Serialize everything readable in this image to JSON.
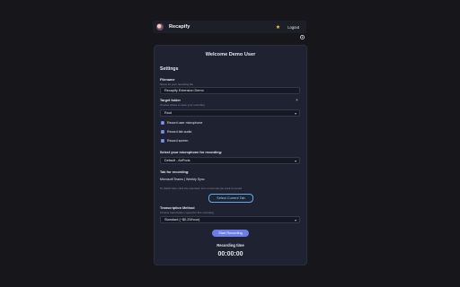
{
  "header": {
    "brand": "Recapify",
    "logout_label": "Logout",
    "star_icon": "star-icon",
    "settings_icon": "gear-icon"
  },
  "main": {
    "welcome": "Welcome Demo User",
    "settings_title": "Settings",
    "filename": {
      "label": "Filename",
      "hint": "Name for your recording file",
      "value": "Recapify Extension Demo"
    },
    "target_folder": {
      "label": "Target folder",
      "hint": "Choose where to save your recording",
      "value": "Root"
    },
    "checkboxes": [
      {
        "label": "Record user microphone",
        "checked": true
      },
      {
        "label": "Record tab audio",
        "checked": true
      },
      {
        "label": "Record screen",
        "checked": true
      }
    ],
    "microphone": {
      "label": "Select your microphone for recording:",
      "value": "Default - AirPods"
    },
    "tab": {
      "label": "Tab for recording:",
      "name": "Microsoft Teams  |  Weekly Sync",
      "hint": "To switch tabs, click the extension icon on the tab you want to record",
      "button": "Select Current Tab"
    },
    "transcription": {
      "label": "Transcription Method",
      "hint": "Choose transcription speed for this recording",
      "value": "Standard (~$0.29/hour)"
    },
    "start_button": "Start Recording",
    "recording_time_label": "Recording time",
    "timer": "00:00:00"
  },
  "colors": {
    "accent": "#6b7ee8",
    "background": "#16161b",
    "card": "#1f2230"
  }
}
